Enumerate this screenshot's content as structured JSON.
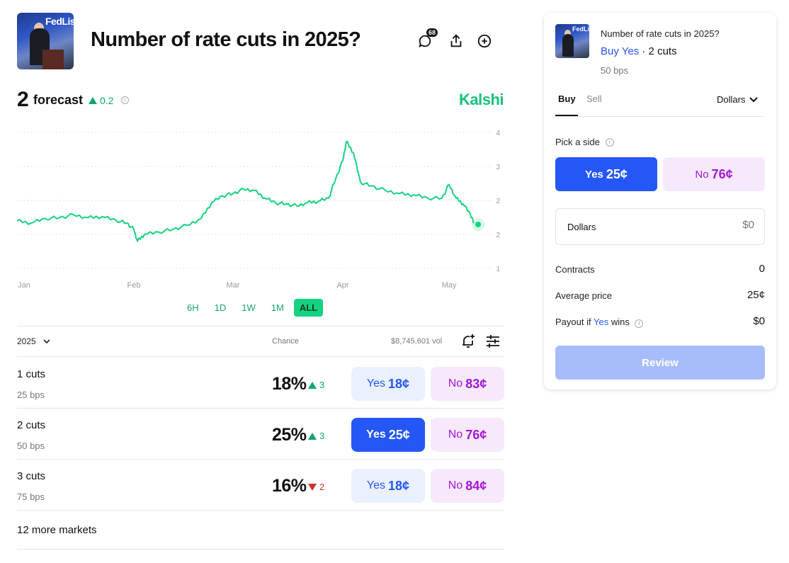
{
  "header": {
    "thumb_text": "FedListen",
    "title": "Number of rate cuts in 2025?",
    "comments_count": "68",
    "icons": [
      "comment-icon",
      "share-icon",
      "add-circle-icon"
    ]
  },
  "forecast": {
    "value": "2",
    "label": "forecast",
    "delta": "0.2",
    "delta_direction": "up",
    "brand": "Kalshi",
    "brand_color": "#14c27b"
  },
  "chart_data": {
    "type": "line",
    "x_labels": [
      "Jan",
      "Feb",
      "Mar",
      "Apr",
      "May"
    ],
    "y_tick_labels": [
      "4",
      "3",
      "2",
      "2",
      "1"
    ],
    "series": [
      {
        "color": "#14d27f",
        "points": [
          [
            "Jan 1",
            2.05
          ],
          [
            "Jan 5",
            2.0
          ],
          [
            "Jan 9",
            2.1
          ],
          [
            "Jan 13",
            2.12
          ],
          [
            "Jan 17",
            2.18
          ],
          [
            "Jan 21",
            2.12
          ],
          [
            "Jan 25",
            2.14
          ],
          [
            "Jan 29",
            2.06
          ],
          [
            "Feb 1",
            2.0
          ],
          [
            "Feb 3",
            1.86
          ],
          [
            "Feb 4",
            1.6
          ],
          [
            "Feb 6",
            1.75
          ],
          [
            "Feb 10",
            1.8
          ],
          [
            "Feb 14",
            1.86
          ],
          [
            "Feb 18",
            1.95
          ],
          [
            "Feb 22",
            2.1
          ],
          [
            "Feb 25",
            2.45
          ],
          [
            "Feb 28",
            2.6
          ],
          [
            "Mar 3",
            2.65
          ],
          [
            "Mar 6",
            2.75
          ],
          [
            "Mar 9",
            2.72
          ],
          [
            "Mar 12",
            2.55
          ],
          [
            "Mar 15",
            2.45
          ],
          [
            "Mar 18",
            2.42
          ],
          [
            "Mar 21",
            2.38
          ],
          [
            "Mar 24",
            2.45
          ],
          [
            "Mar 27",
            2.48
          ],
          [
            "Mar 30",
            2.55
          ],
          [
            "Apr 1",
            2.98
          ],
          [
            "Apr 3",
            3.38
          ],
          [
            "Apr 4",
            3.8
          ],
          [
            "Apr 6",
            3.55
          ],
          [
            "Apr 8",
            2.9
          ],
          [
            "Apr 11",
            2.82
          ],
          [
            "Apr 15",
            2.72
          ],
          [
            "Apr 19",
            2.65
          ],
          [
            "Apr 23",
            2.62
          ],
          [
            "Apr 27",
            2.55
          ],
          [
            "May 1",
            2.55
          ],
          [
            "May 3",
            2.85
          ],
          [
            "May 5",
            2.55
          ],
          [
            "May 7",
            2.42
          ],
          [
            "May 9",
            2.2
          ],
          [
            "May 10",
            2.0
          ]
        ]
      }
    ],
    "title": "",
    "xlabel": "",
    "ylabel": "",
    "grid": true,
    "legend": false
  },
  "ranges": [
    {
      "label": "6H",
      "active": false
    },
    {
      "label": "1D",
      "active": false
    },
    {
      "label": "1W",
      "active": false
    },
    {
      "label": "1M",
      "active": false
    },
    {
      "label": "ALL",
      "active": true
    }
  ],
  "table": {
    "year": "2025",
    "chance_header": "Chance",
    "volume": "$8,745,601 vol",
    "rows": [
      {
        "name": "1 cuts",
        "sub": "25 bps",
        "pct": "18%",
        "chg": "3",
        "dir": "up",
        "yes": "Yes",
        "yes_price": "18¢",
        "no": "No",
        "no_price": "83¢",
        "selected": false
      },
      {
        "name": "2 cuts",
        "sub": "50 bps",
        "pct": "25%",
        "chg": "3",
        "dir": "up",
        "yes": "Yes",
        "yes_price": "25¢",
        "no": "No",
        "no_price": "76¢",
        "selected": true
      },
      {
        "name": "3 cuts",
        "sub": "75 bps",
        "pct": "16%",
        "chg": "2",
        "dir": "down",
        "yes": "Yes",
        "yes_price": "18¢",
        "no": "No",
        "no_price": "84¢",
        "selected": false
      }
    ],
    "more": "12 more markets"
  },
  "panel": {
    "thumb_text": "FedListen",
    "question": "Number of rate cuts in 2025?",
    "selection_prefix": "Buy Yes",
    "selection_suffix": "· 2 cuts",
    "bps": "50 bps",
    "tabs": [
      "Buy",
      "Sell"
    ],
    "unit": "Dollars",
    "pick_side": "Pick a side",
    "yes_label": "Yes",
    "yes_price": "25¢",
    "no_label": "No",
    "no_price": "76¢",
    "amount_label": "Dollars",
    "amount_placeholder": "$0",
    "contracts_label": "Contracts",
    "contracts_value": "0",
    "avg_label": "Average price",
    "avg_value": "25¢",
    "payout_prefix": "Payout if",
    "payout_side": "Yes",
    "payout_suffix": "wins",
    "payout_value": "$0",
    "review": "Review"
  }
}
